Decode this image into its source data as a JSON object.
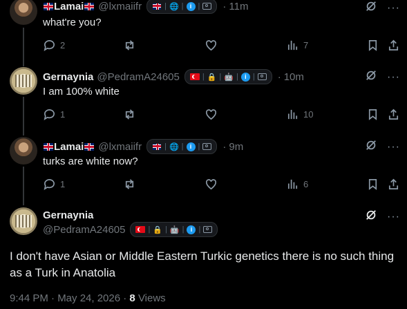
{
  "posts": [
    {
      "name": "Lamai",
      "handle": "@lxmaiifr",
      "time": "11m",
      "text": "what're you?",
      "replies": "2",
      "views": "7"
    },
    {
      "name": "Gernaynia",
      "handle": "@PedramA24605",
      "time": "10m",
      "text": "I am 100% white",
      "replies": "1",
      "views": "10"
    },
    {
      "name": "Lamai",
      "handle": "@lxmaiifr",
      "time": "9m",
      "text": "turks are white now?",
      "replies": "1",
      "views": "6"
    }
  ],
  "main": {
    "name": "Gernaynia",
    "handle": "@PedramA24605",
    "text": "I don't have Asian or Middle Eastern Turkic genetics there is no such thing as a Turk in Anatolia",
    "date": "9:44 PM · May 24, 2026 · ",
    "views_count": "8",
    "views_label": "Views"
  },
  "colors": {
    "background": "#000000",
    "text": "#e7e9ea",
    "muted": "#71767b",
    "accent": "#1d9bf0"
  },
  "icons": [
    "reply-icon",
    "retweet-icon",
    "like-icon",
    "views-icon",
    "bookmark-icon",
    "share-icon",
    "grok-icon",
    "more-icon"
  ]
}
